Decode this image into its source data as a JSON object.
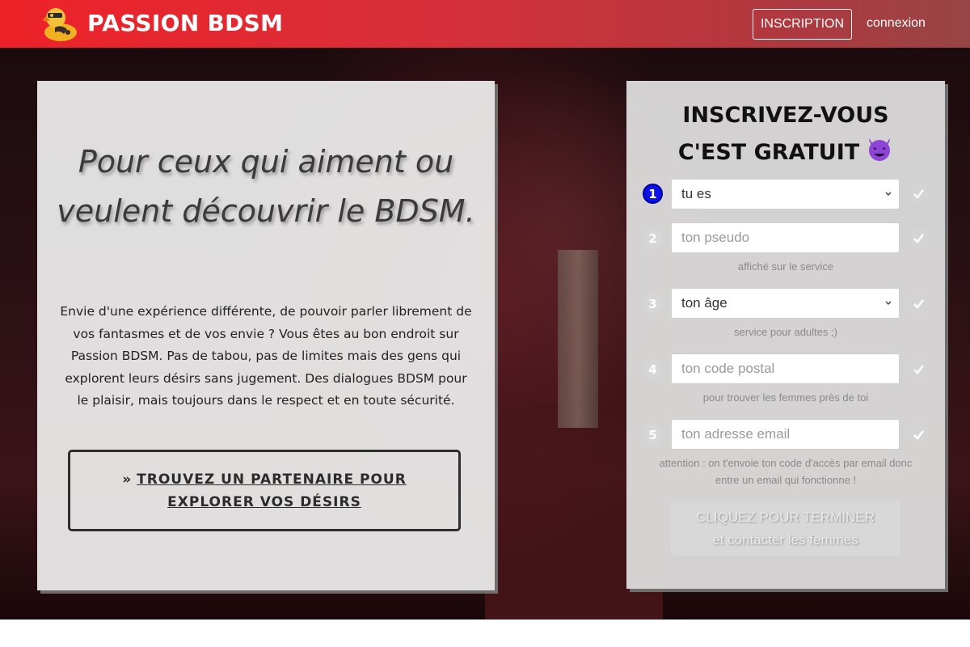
{
  "header": {
    "brand": "PASSION BDSM",
    "register_label": "INSCRIPTION",
    "login_label": "connexion",
    "gradient_start": "#ee2128",
    "gradient_end": "#984545"
  },
  "hero": {
    "headline": "Pour ceux qui aiment ou veulent découvrir le BDSM.",
    "intro": "Envie d'une expérience différente, de pouvoir parler librement de vos fantasmes et de vos envie ? Vous êtes au bon endroit sur Passion BDSM. Pas de tabou, pas de limites mais des gens qui explorent leurs désirs sans jugement. Des dialogues BDSM pour le plaisir, mais toujours dans le respect et en toute sécurité.",
    "cta_chevron": "»",
    "cta_label": "TROUVEZ UN PARTENAIRE POUR EXPLORER VOS DÉSIRS"
  },
  "signup": {
    "title_line1": "INSCRIVEZ-VOUS",
    "title_line2": "C'EST GRATUIT",
    "title_emoji_icon": "smiling-devil-icon",
    "steps": [
      {
        "number": "1",
        "value": "tu es",
        "placeholder": "",
        "hint": ""
      },
      {
        "number": "2",
        "value": "",
        "placeholder": "ton pseudo",
        "hint": "affiché sur le service"
      },
      {
        "number": "3",
        "value": "ton âge",
        "placeholder": "",
        "hint": "service pour adultes ;)"
      },
      {
        "number": "4",
        "value": "",
        "placeholder": "ton code postal",
        "hint": "pour trouver les femmes près de toi"
      },
      {
        "number": "5",
        "value": "",
        "placeholder": "ton adresse email",
        "hint": "attention : on t'envoie ton code d'accès par email donc entre un email qui fonctionne !"
      }
    ],
    "submit_line1": "CLIQUEZ POUR TERMINER",
    "submit_line2": "et contacter les femmes",
    "active_step_color": "#0a12e6"
  }
}
